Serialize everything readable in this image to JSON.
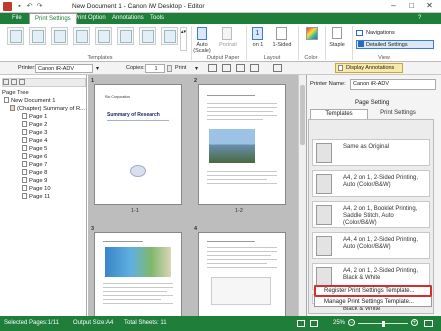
{
  "window": {
    "title": "New Document 1 - Canon iW Desktop - Editor"
  },
  "menu_tabs": [
    {
      "label": "File"
    },
    {
      "label": "Print Settings"
    },
    {
      "label": "Print Option"
    },
    {
      "label": "Annotations"
    },
    {
      "label": "Tools"
    }
  ],
  "ribbon": {
    "groups": {
      "templates": "Templates",
      "output_paper": "Output Paper",
      "layout": "Layout",
      "color": "Color",
      "view": "View"
    },
    "auto_label": "Auto (Scale)",
    "portrait_label": "Portrait",
    "pages_per_sheet_value": "1",
    "pages_per_sheet_label": "on 1",
    "sided_label": "1-Sided",
    "staple_label": "Staple",
    "navigations_label": "Navigations",
    "detailed_settings_label": "Detailed Settings"
  },
  "toolbar": {
    "printer_label": "Printer:",
    "printer_value": "Canon iR-ADV",
    "copies_label": "Copies:",
    "copies_value": "1",
    "print_label": "Print",
    "display_annotations_label": "Display Annotations"
  },
  "page_tree": {
    "header": "Page Tree",
    "root": "New Document 1",
    "chapter": "(Chapter) Summary of R...",
    "pages": [
      "Page 1",
      "Page 2",
      "Page 3",
      "Page 4",
      "Page 5",
      "Page 6",
      "Page 7",
      "Page 8",
      "Page 9",
      "Page 10",
      "Page 11"
    ]
  },
  "canvas": {
    "chapter_numbers": [
      "1",
      "2",
      "3",
      "4"
    ],
    "page_labels": [
      "1-1",
      "1-2"
    ],
    "page1_company": "Rio Corporation",
    "page1_title": "Summary of Research"
  },
  "right_panel": {
    "printer_label": "Printer Name:",
    "printer_value": "Canon iR-ADV",
    "heading": "Page Setting",
    "tabs": [
      "Templates",
      "Print Settings"
    ],
    "templates": [
      {
        "label": "Same as Original"
      },
      {
        "label": "A4, 2 on 1, 2-Sided Printing, Auto (Color/B&W)"
      },
      {
        "label": "A4, 2 on 1, Booklet Printing, Saddle Stitch, Auto (Color/B&W)"
      },
      {
        "label": "A4, 4 on 1, 2-Sided Printing, Auto (Color/B&W)"
      },
      {
        "label": "A4, 2 on 1, 2-Sided Printing, Black & White"
      },
      {
        "label": "A4, 4 on 1, 2-Sided Printing, Black & White"
      }
    ],
    "menu": {
      "register": "Register Print Settings Template...",
      "manage": "Manage Print Settings Template..."
    }
  },
  "status": {
    "selected_pages": "Selected Pages:1/11",
    "output_size": "Output Size:A4",
    "total_sheets": "Total Sheets: 11",
    "zoom": "25%"
  },
  "colors": {
    "accent": "#1e7e3a",
    "highlight": "#d32f2f"
  }
}
